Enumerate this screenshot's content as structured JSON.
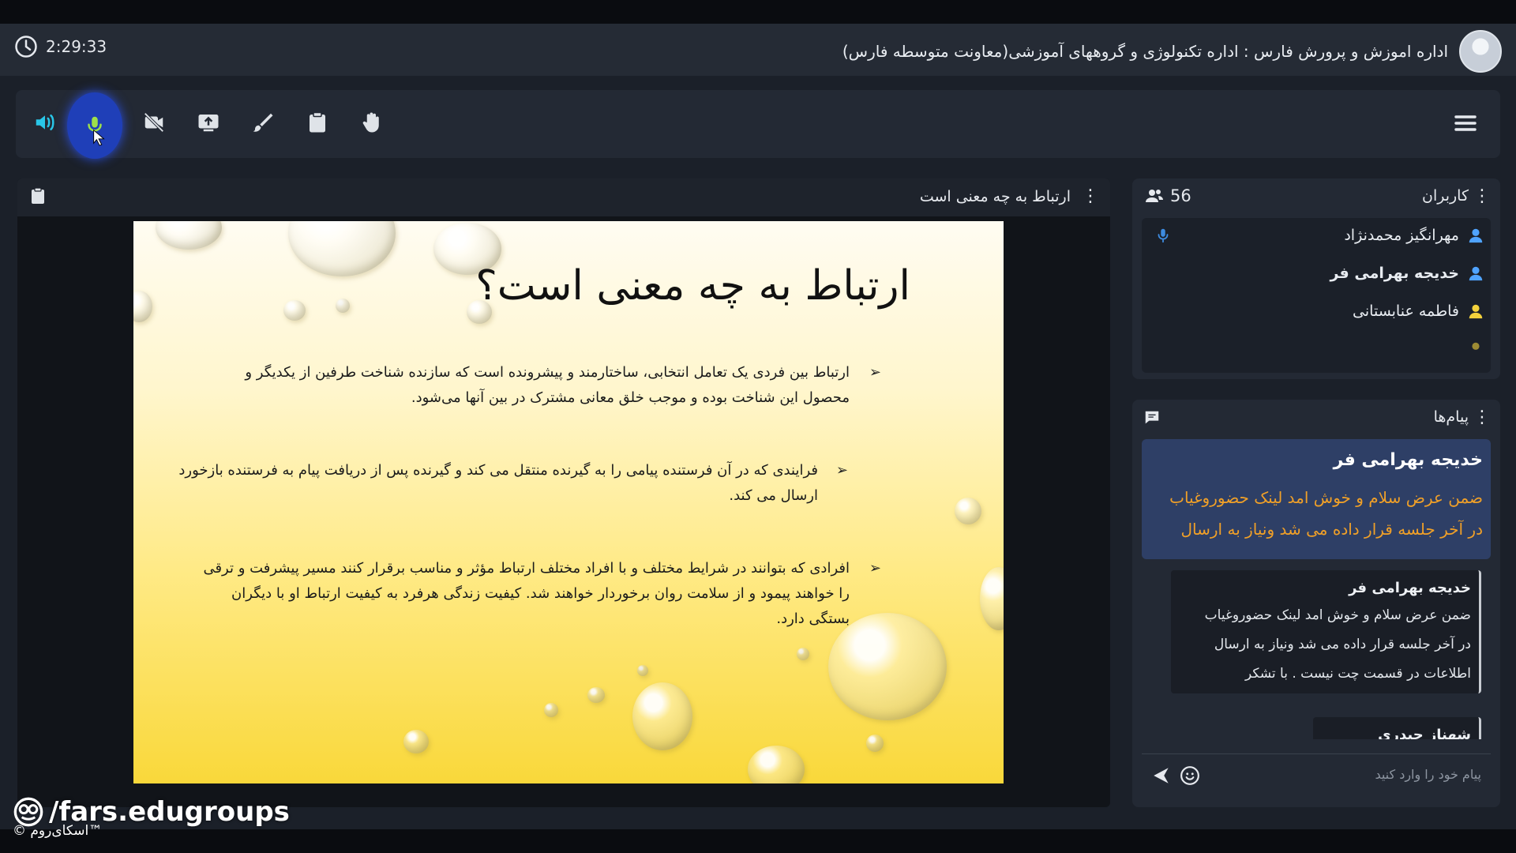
{
  "header": {
    "timer": "2:29:33",
    "org_title": "اداره اموزش و پرورش فارس : اداره تکنولوژی و گروههای آموزشی(معاونت متوسطه فارس)"
  },
  "toolbar": {
    "buttons": [
      "speaker-icon",
      "microphone-icon",
      "camera-off-icon",
      "share-screen-icon",
      "brush-icon",
      "clipboard-icon",
      "raise-hand-icon"
    ],
    "active_button": "microphone-icon",
    "accent_color": "#1f3fb8"
  },
  "stage": {
    "title": "ارتباط به چه معنی است"
  },
  "slide": {
    "title": "ارتباط به چه معنی است؟",
    "bullets": [
      "ارتباط بین فردی یک تعامل انتخابی، ساختارمند و پیشرونده است که سازنده شناخت طرفین از یکدیگر و محصول این شناخت بوده و موجب خلق معانی مشترک در بین آنها می‌شود.",
      "فرایندی که در آن فرستنده پیامی را به گیرنده منتقل می کند و گیرنده پس از دریافت پیام به فرستنده بازخورد ارسال می کند.",
      "افرادی که بتوانند در شرایط مختلف و با افراد مختلف ارتباط مؤثر و مناسب برقرار کنند مسیر پیشرفت و ترقی را خواهند پیمود و از سلامت روان برخوردار خواهند شد. کیفیت زندگی هرفرد به کیفیت ارتباط او با دیگران بستگی دارد."
    ]
  },
  "users": {
    "title": "کاربران",
    "count": "56",
    "list": [
      {
        "name": "مهرانگیز محمدنژاد",
        "icon_color": "#4fa3ff",
        "bold": false
      },
      {
        "name": "خدیجه بهرامی فر",
        "icon_color": "#4fa3ff",
        "bold": true
      },
      {
        "name": "فاطمه عنابستانی",
        "icon_color": "#f4d23c",
        "bold": false
      }
    ]
  },
  "chat": {
    "title": "پیام‌ها",
    "highlight": {
      "sender": "خدیجه بهرامی فر",
      "line1": "ضمن عرض سلام و خوش امد لینک حضوروغیاب",
      "line2": "در آخر جلسه قرار داده می شد ونیاز به ارسال"
    },
    "messages": [
      {
        "sender": "خدیجه بهرامی فر",
        "line1": "ضمن عرض سلام و خوش امد لینک حضوروغیاب",
        "line2": "در آخر جلسه قرار داده می شد ونیاز به ارسال",
        "line3": "اطلاعات در قسمت چت نیست . با تشکر"
      },
      {
        "sender": "شهناز حیدری"
      }
    ],
    "input_placeholder": "پیام خود را وارد کنید"
  },
  "watermark": {
    "handle": "/fars.edugroups",
    "brand": "© اسکای‌روم™"
  }
}
